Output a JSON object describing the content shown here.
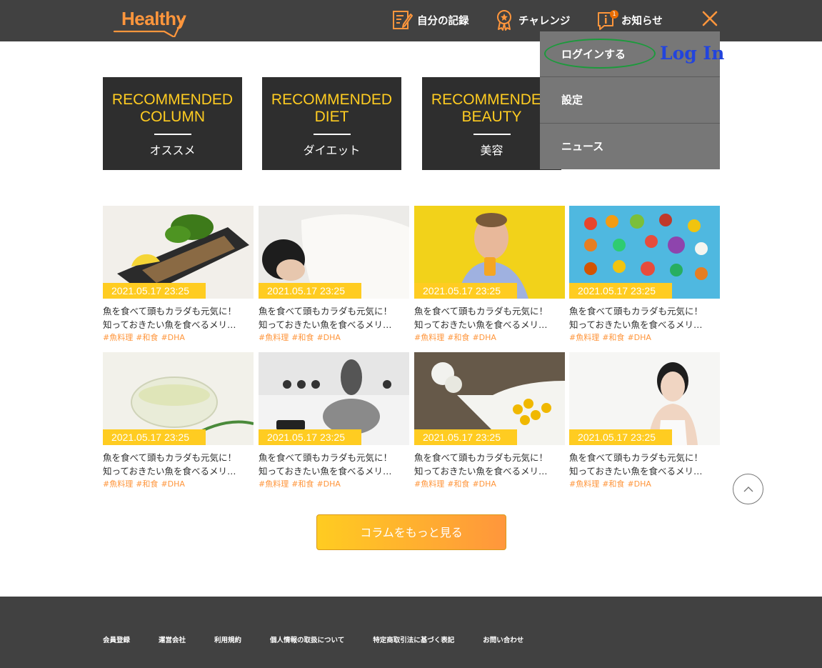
{
  "header": {
    "logo_text": "Healthy",
    "nav": [
      {
        "label": "自分の記録",
        "icon": "memo-icon"
      },
      {
        "label": "チャレンジ",
        "icon": "medal-icon"
      },
      {
        "label": "お知らせ",
        "icon": "info-icon",
        "badge": "1"
      }
    ]
  },
  "menu": {
    "items": [
      "ログインする",
      "設定",
      "ニュース"
    ],
    "annotation": "Log In"
  },
  "categories": [
    {
      "en_line1": "RECOMMENDED",
      "en_line2": "COLUMN",
      "jp": "オススメ"
    },
    {
      "en_line1": "RECOMMENDED",
      "en_line2": "DIET",
      "jp": "ダイエット"
    },
    {
      "en_line1": "RECOMMENDED",
      "en_line2": "BEAUTY",
      "jp": "美容"
    }
  ],
  "cards": [
    {
      "date": "2021.05.17 23:25",
      "line1": "魚を食べて頭もカラダも元気に！",
      "line2": "知っておきたい魚を食べるメリ…",
      "tags": [
        "#魚料理",
        "#和食",
        "#DHA"
      ]
    },
    {
      "date": "2021.05.17 23:25",
      "line1": "魚を食べて頭もカラダも元気に！",
      "line2": "知っておきたい魚を食べるメリ…",
      "tags": [
        "#魚料理",
        "#和食",
        "#DHA"
      ]
    },
    {
      "date": "2021.05.17 23:25",
      "line1": "魚を食べて頭もカラダも元気に！",
      "line2": "知っておきたい魚を食べるメリ…",
      "tags": [
        "#魚料理",
        "#和食",
        "#DHA"
      ]
    },
    {
      "date": "2021.05.17 23:25",
      "line1": "魚を食べて頭もカラダも元気に！",
      "line2": "知っておきたい魚を食べるメリ…",
      "tags": [
        "#魚料理",
        "#和食",
        "#DHA"
      ]
    },
    {
      "date": "2021.05.17 23:25",
      "line1": "魚を食べて頭もカラダも元気に！",
      "line2": "知っておきたい魚を食べるメリ…",
      "tags": [
        "#魚料理",
        "#和食",
        "#DHA"
      ]
    },
    {
      "date": "2021.05.17 23:25",
      "line1": "魚を食べて頭もカラダも元気に！",
      "line2": "知っておきたい魚を食べるメリ…",
      "tags": [
        "#魚料理",
        "#和食",
        "#DHA"
      ]
    },
    {
      "date": "2021.05.17 23:25",
      "line1": "魚を食べて頭もカラダも元気に！",
      "line2": "知っておきたい魚を食べるメリ…",
      "tags": [
        "#魚料理",
        "#和食",
        "#DHA"
      ]
    },
    {
      "date": "2021.05.17 23:25",
      "line1": "魚を食べて頭もカラダも元気に！",
      "line2": "知っておきたい魚を食べるメリ…",
      "tags": [
        "#魚料理",
        "#和食",
        "#DHA"
      ]
    }
  ],
  "more_button": "コラムをもっと見る",
  "footer": {
    "links": [
      "会員登録",
      "運営会社",
      "利用規約",
      "個人情報の取扱について",
      "特定商取引法に基づく表記",
      "お問い合わせ"
    ]
  },
  "colors": {
    "primary": "#ff963c",
    "yellow": "#ffcc21",
    "dark": "#414141",
    "menu": "#777777"
  }
}
